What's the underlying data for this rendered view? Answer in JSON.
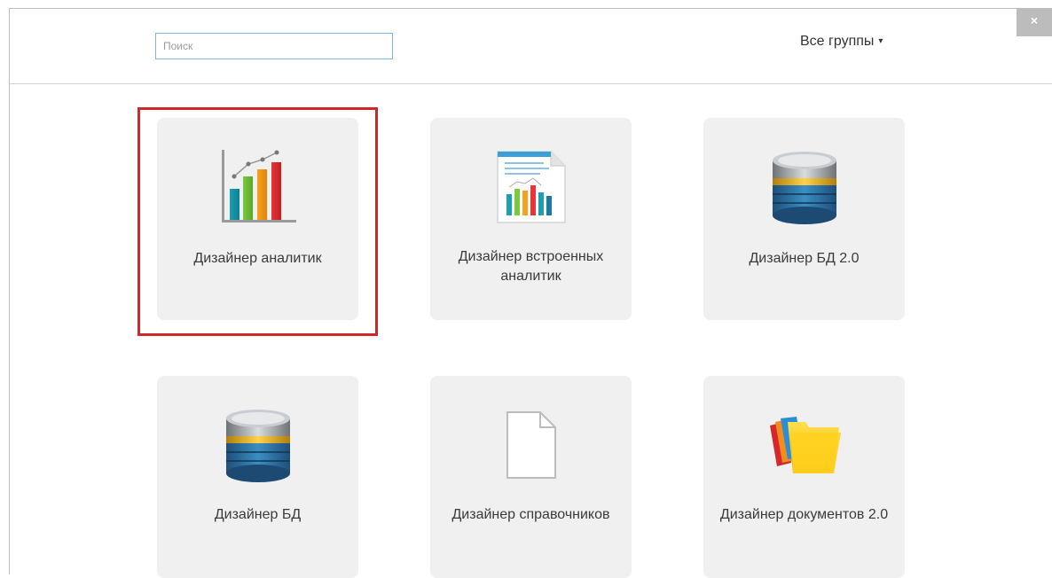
{
  "search": {
    "placeholder": "Поиск",
    "value": ""
  },
  "groups_filter": {
    "label": "Все группы",
    "caret": "▾"
  },
  "close": {
    "symbol": "×"
  },
  "tiles": [
    {
      "label": "Дизайнер аналитик",
      "icon": "bar-chart-icon",
      "selected": true
    },
    {
      "label": "Дизайнер встроенных аналитик",
      "icon": "chart-document-icon",
      "selected": false
    },
    {
      "label": "Дизайнер БД 2.0",
      "icon": "database-icon",
      "selected": false
    },
    {
      "label": "Дизайнер БД",
      "icon": "database-icon",
      "selected": false
    },
    {
      "label": "Дизайнер справочников",
      "icon": "blank-document-icon",
      "selected": false
    },
    {
      "label": "Дизайнер документов 2.0",
      "icon": "folders-icon",
      "selected": false
    }
  ],
  "colors": {
    "selection": "#d0262c",
    "tile_bg": "#f0f0f0",
    "search_border": "#79b6dc"
  }
}
